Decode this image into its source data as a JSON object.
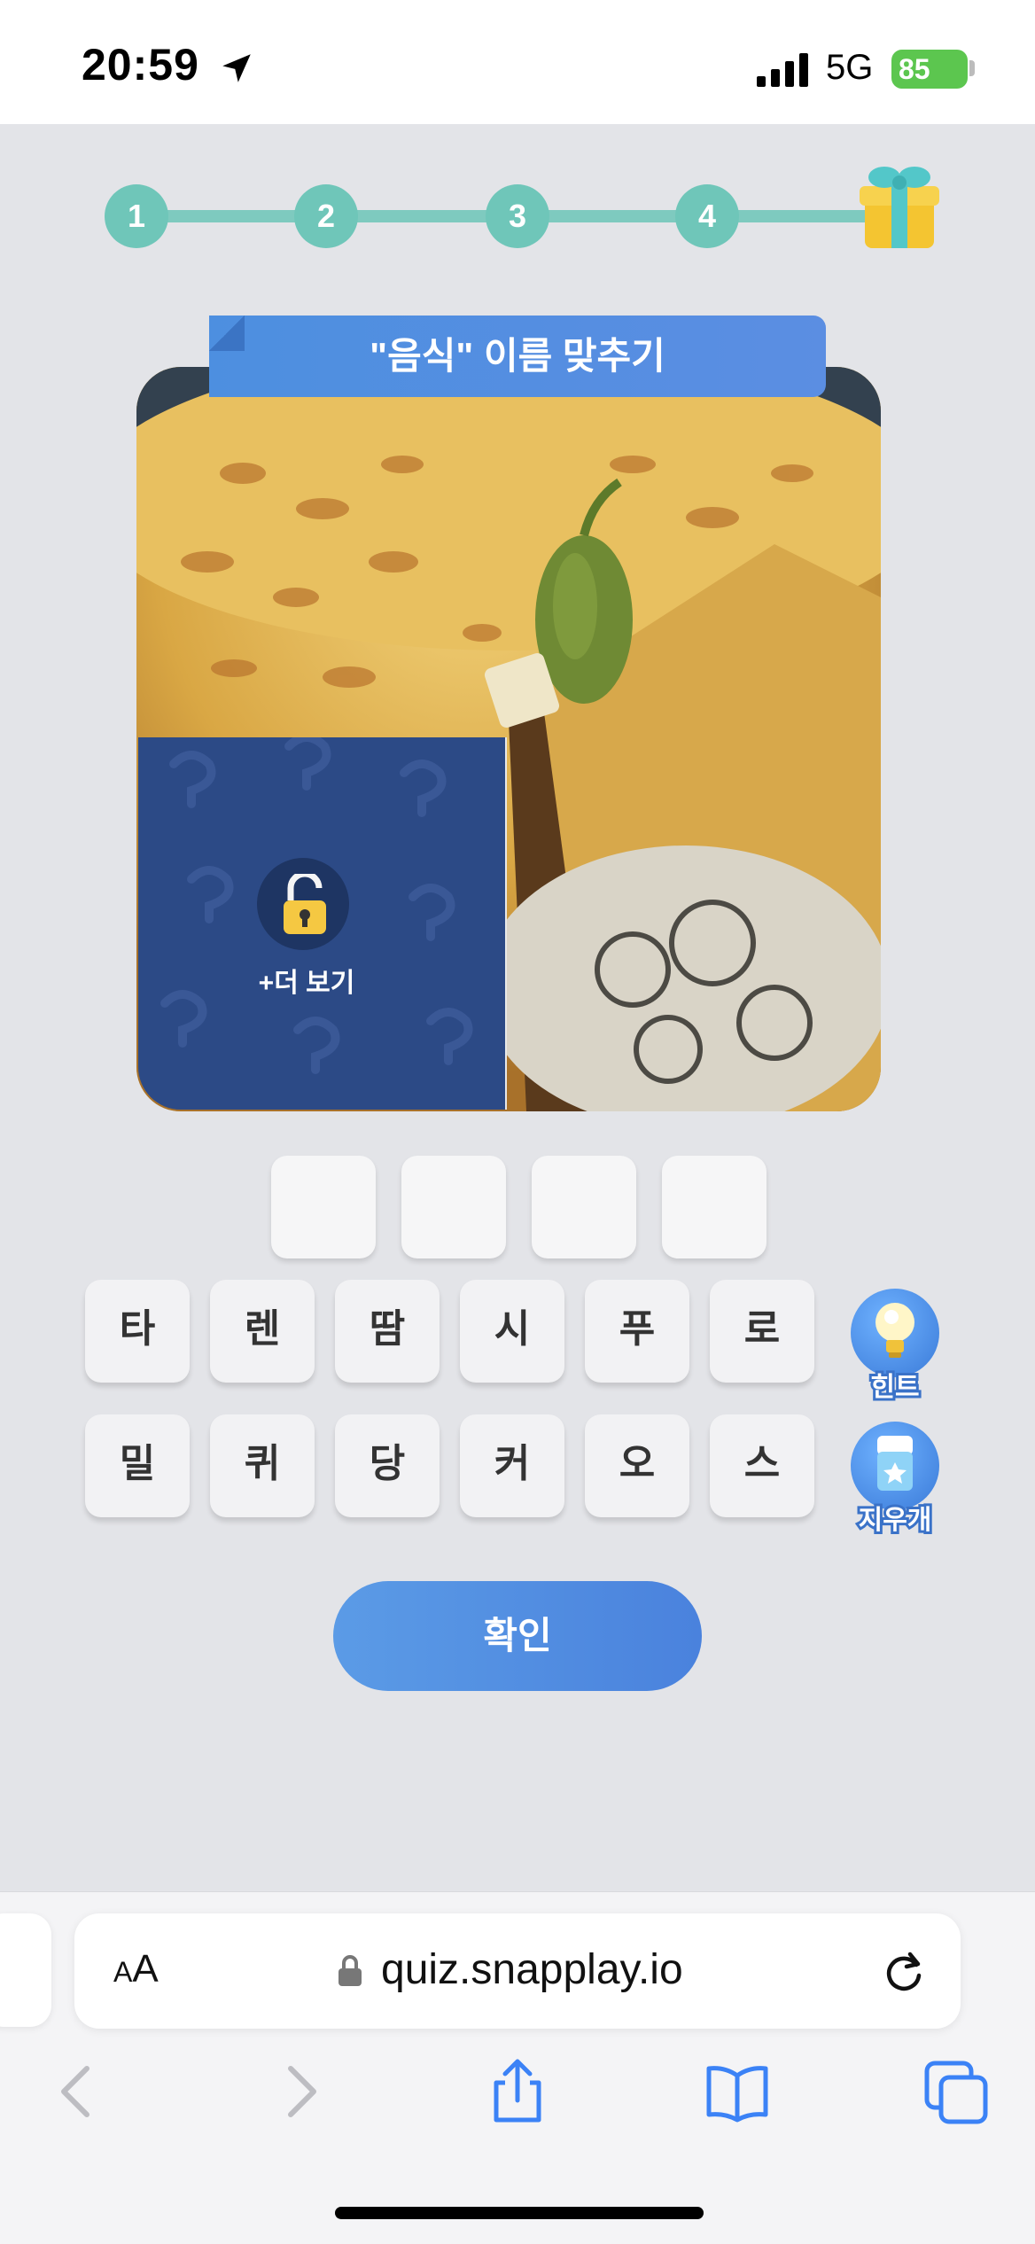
{
  "status_bar": {
    "time": "20:59",
    "network": "5G",
    "battery": "85"
  },
  "progress": {
    "steps": [
      "1",
      "2",
      "3",
      "4"
    ],
    "reward_icon": "gift-icon"
  },
  "quiz": {
    "title": "\"음식\" 이름 맞추기",
    "see_more_label": "+더 보기",
    "answer_slots": [
      "",
      "",
      "",
      ""
    ],
    "letters_row1": [
      "타",
      "렌",
      "땀",
      "시",
      "푸",
      "로"
    ],
    "letters_row2": [
      "밀",
      "퀴",
      "당",
      "커",
      "오",
      "스"
    ],
    "hint_label": "힌트",
    "eraser_label": "지우개",
    "confirm_label": "확인"
  },
  "browser": {
    "text_size_label_small": "A",
    "text_size_label_large": "A",
    "url": "quiz.snapplay.io"
  },
  "colors": {
    "progress": "#6fc6b9",
    "accent": "#4d8fe0",
    "tile": "#2c4a86"
  }
}
